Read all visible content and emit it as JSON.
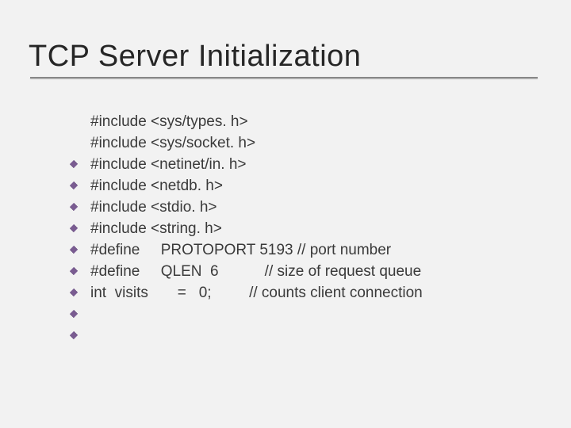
{
  "title": "TCP Server Initialization",
  "lines": [
    "#include <sys/types. h>",
    "#include <sys/socket. h>",
    "#include <netinet/in. h>",
    "#include <netdb. h>",
    "#include <stdio. h>",
    "#include <string. h>",
    "#define     PROTOPORT 5193 // port number",
    "#define     QLEN  6           // size of request queue",
    "int  visits       =   0;         // counts client connection"
  ]
}
